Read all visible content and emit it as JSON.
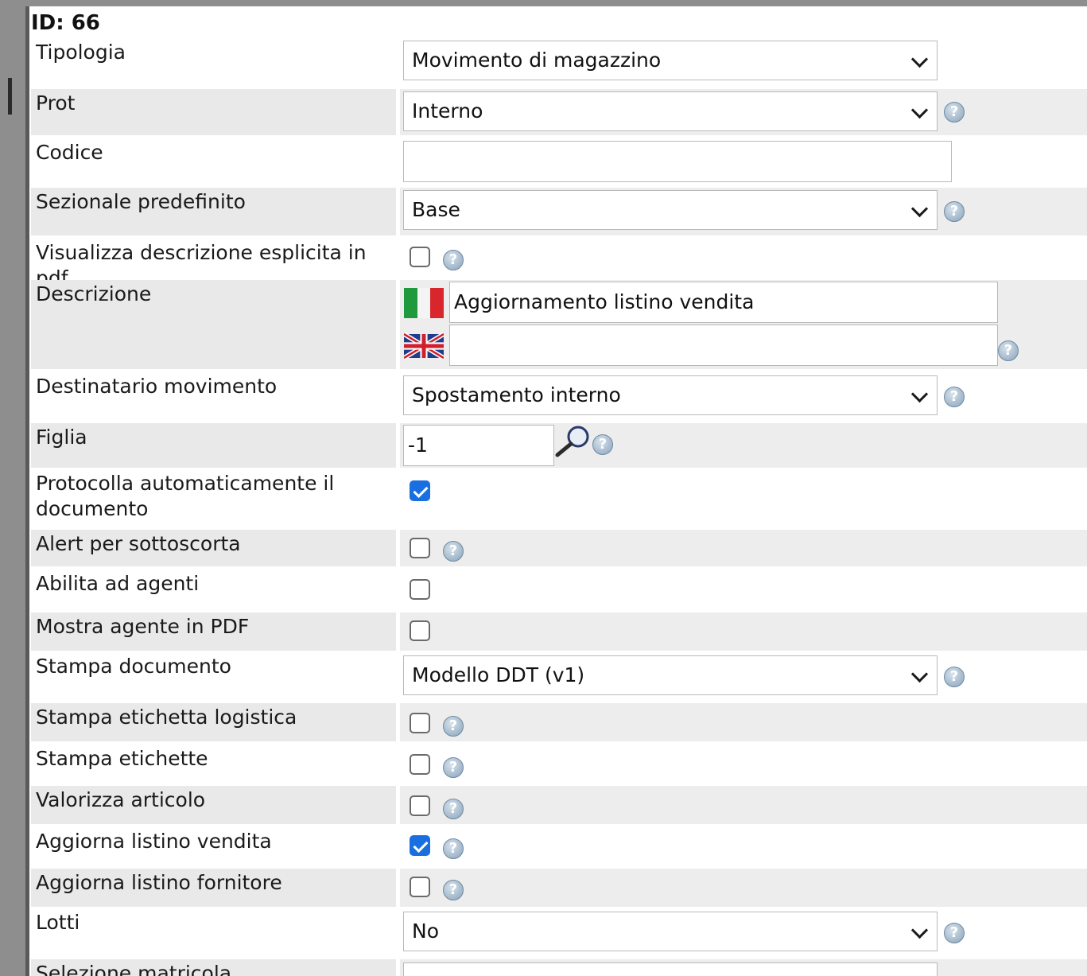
{
  "record": {
    "id_label": "ID: 66"
  },
  "form": {
    "tipologia": {
      "label": "Tipologia",
      "value": "Movimento di magazzino"
    },
    "prot": {
      "label": "Prot",
      "value": "Interno"
    },
    "codice": {
      "label": "Codice",
      "value": ""
    },
    "sezionale": {
      "label": "Sezionale predefinito",
      "value": "Base"
    },
    "visualizza_descrizione": {
      "label": "Visualizza descrizione esplicita in pdf",
      "checked": false
    },
    "descrizione": {
      "label": "Descrizione",
      "it_value": "Aggiornamento listino vendita",
      "en_value": ""
    },
    "destinatario": {
      "label": "Destinatario movimento",
      "value": "Spostamento interno"
    },
    "figlia": {
      "label": "Figlia",
      "value": "-1"
    },
    "protocolla": {
      "label": "Protocolla automaticamente il documento",
      "checked": true
    },
    "alert_sottoscorta": {
      "label": "Alert per sottoscorta",
      "checked": false
    },
    "abilita_agenti": {
      "label": "Abilita ad agenti",
      "checked": false
    },
    "mostra_agente": {
      "label": "Mostra agente in PDF",
      "checked": false
    },
    "stampa_documento": {
      "label": "Stampa documento",
      "value": "Modello DDT (v1)"
    },
    "stampa_etichetta_logistica": {
      "label": "Stampa etichetta logistica",
      "checked": false
    },
    "stampa_etichette": {
      "label": "Stampa etichette",
      "checked": false
    },
    "valorizza_articolo": {
      "label": "Valorizza articolo",
      "checked": false
    },
    "aggiorna_listino_vendita": {
      "label": "Aggiorna listino vendita",
      "checked": true
    },
    "aggiorna_listino_fornitore": {
      "label": "Aggiorna listino fornitore",
      "checked": false
    },
    "lotti": {
      "label": "Lotti",
      "value": "No"
    },
    "selezione_matricola": {
      "label": "Selezione matricola"
    }
  },
  "icons": {
    "help": "question-mark-icon",
    "search": "magnifier-icon",
    "flag_it": "italy-flag-icon",
    "flag_en": "uk-flag-icon"
  },
  "colors": {
    "row_shade": "#e9e9e9",
    "checkbox_checked": "#1a6fe0",
    "help_icon": "#8aa3ba"
  },
  "help_glyph": "?"
}
